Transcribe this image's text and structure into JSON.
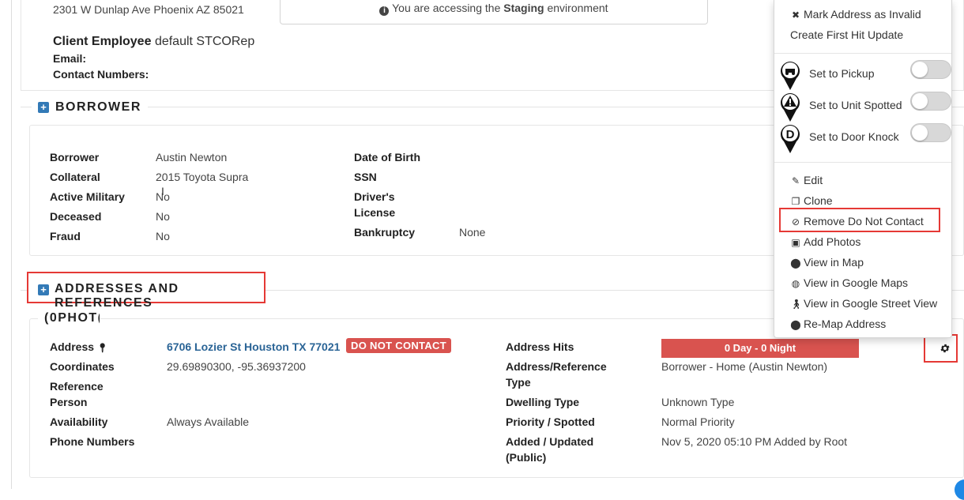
{
  "client": {
    "address": "2301 W Dunlap Ave Phoenix AZ 85021",
    "employee_label": "Client Employee",
    "employee_value": "default STCORep",
    "email_label": "Email:",
    "contact_label": "Contact Numbers:"
  },
  "staging": {
    "icon": "info-circle-icon",
    "prefix": "You are accessing the",
    "env": "Staging",
    "suffix": "environment"
  },
  "borrower_section": {
    "title": "BORROWER",
    "left": [
      {
        "label": "Borrower",
        "value": "Austin Newton"
      },
      {
        "label": "Collateral",
        "value": "2015 Toyota Supra"
      },
      {
        "label": "Active Military",
        "value": "No"
      },
      {
        "label": "Deceased",
        "value": "No"
      },
      {
        "label": "Fraud",
        "value": "No"
      }
    ],
    "right": {
      "dob_label": "Date of Birth",
      "ssn_label": "SSN",
      "dl_label_1": "Driver's",
      "dl_label_2": "License",
      "bankruptcy_label": "Bankruptcy",
      "bankruptcy_value": "None"
    }
  },
  "addresses_section": {
    "title": "ADDRESSES AND REFERENCES",
    "subheading": "(0PHOT(",
    "left": {
      "address_label": "Address",
      "address_value": "6706 Lozier St Houston TX 77021",
      "dnc_badge": "DO NOT CONTACT",
      "coordinates_label": "Coordinates",
      "coordinates_value": "29.69890300, -95.36937200",
      "reference_label_1": "Reference",
      "reference_label_2": "Person",
      "availability_label": "Availability",
      "availability_value": "Always Available",
      "phone_label": "Phone Numbers"
    },
    "right": {
      "hits_label": "Address Hits",
      "hits_value": "0 Day - 0 Night",
      "type_label_1": "Address/Reference",
      "type_label_2": "Type",
      "type_value": "Borrower - Home (Austin Newton)",
      "dwelling_label": "Dwelling Type",
      "dwelling_value": "Unknown Type",
      "priority_label": "Priority / Spotted",
      "priority_value": "Normal Priority",
      "added_label_1": "Added / Updated",
      "added_label_2": "(Public)",
      "added_value": "Nov 5, 2020 05:10 PM Added by Root"
    }
  },
  "menu": {
    "top_items": [
      {
        "icon": "times-icon",
        "label": "Mark Address as Invalid"
      },
      {
        "icon": "",
        "label": "Create First Hit Update"
      }
    ],
    "toggles": [
      {
        "pin": "tow-truck-pin-icon",
        "label": "Set to Pickup"
      },
      {
        "pin": "warning-pin-icon",
        "label": "Set to Unit Spotted"
      },
      {
        "pin": "door-knock-pin-icon",
        "label": "Set to Door Knock"
      }
    ],
    "items": [
      {
        "icon": "edit-icon",
        "label": "Edit"
      },
      {
        "icon": "clone-icon",
        "label": "Clone"
      },
      {
        "icon": "ban-icon",
        "label": "Remove Do Not Contact"
      },
      {
        "icon": "image-icon",
        "label": "Add Photos"
      },
      {
        "icon": "map-marker-icon",
        "label": "View in Map"
      },
      {
        "icon": "globe-icon",
        "label": "View in Google Maps"
      },
      {
        "icon": "street-view-icon",
        "label": "View in Google Street View"
      },
      {
        "icon": "map-marker-icon",
        "label": "Re-Map Address"
      }
    ]
  },
  "colors": {
    "link": "#2a6496",
    "danger": "#d9534f",
    "highlight_outline": "#e53935",
    "section_icon": "#337ab7"
  }
}
